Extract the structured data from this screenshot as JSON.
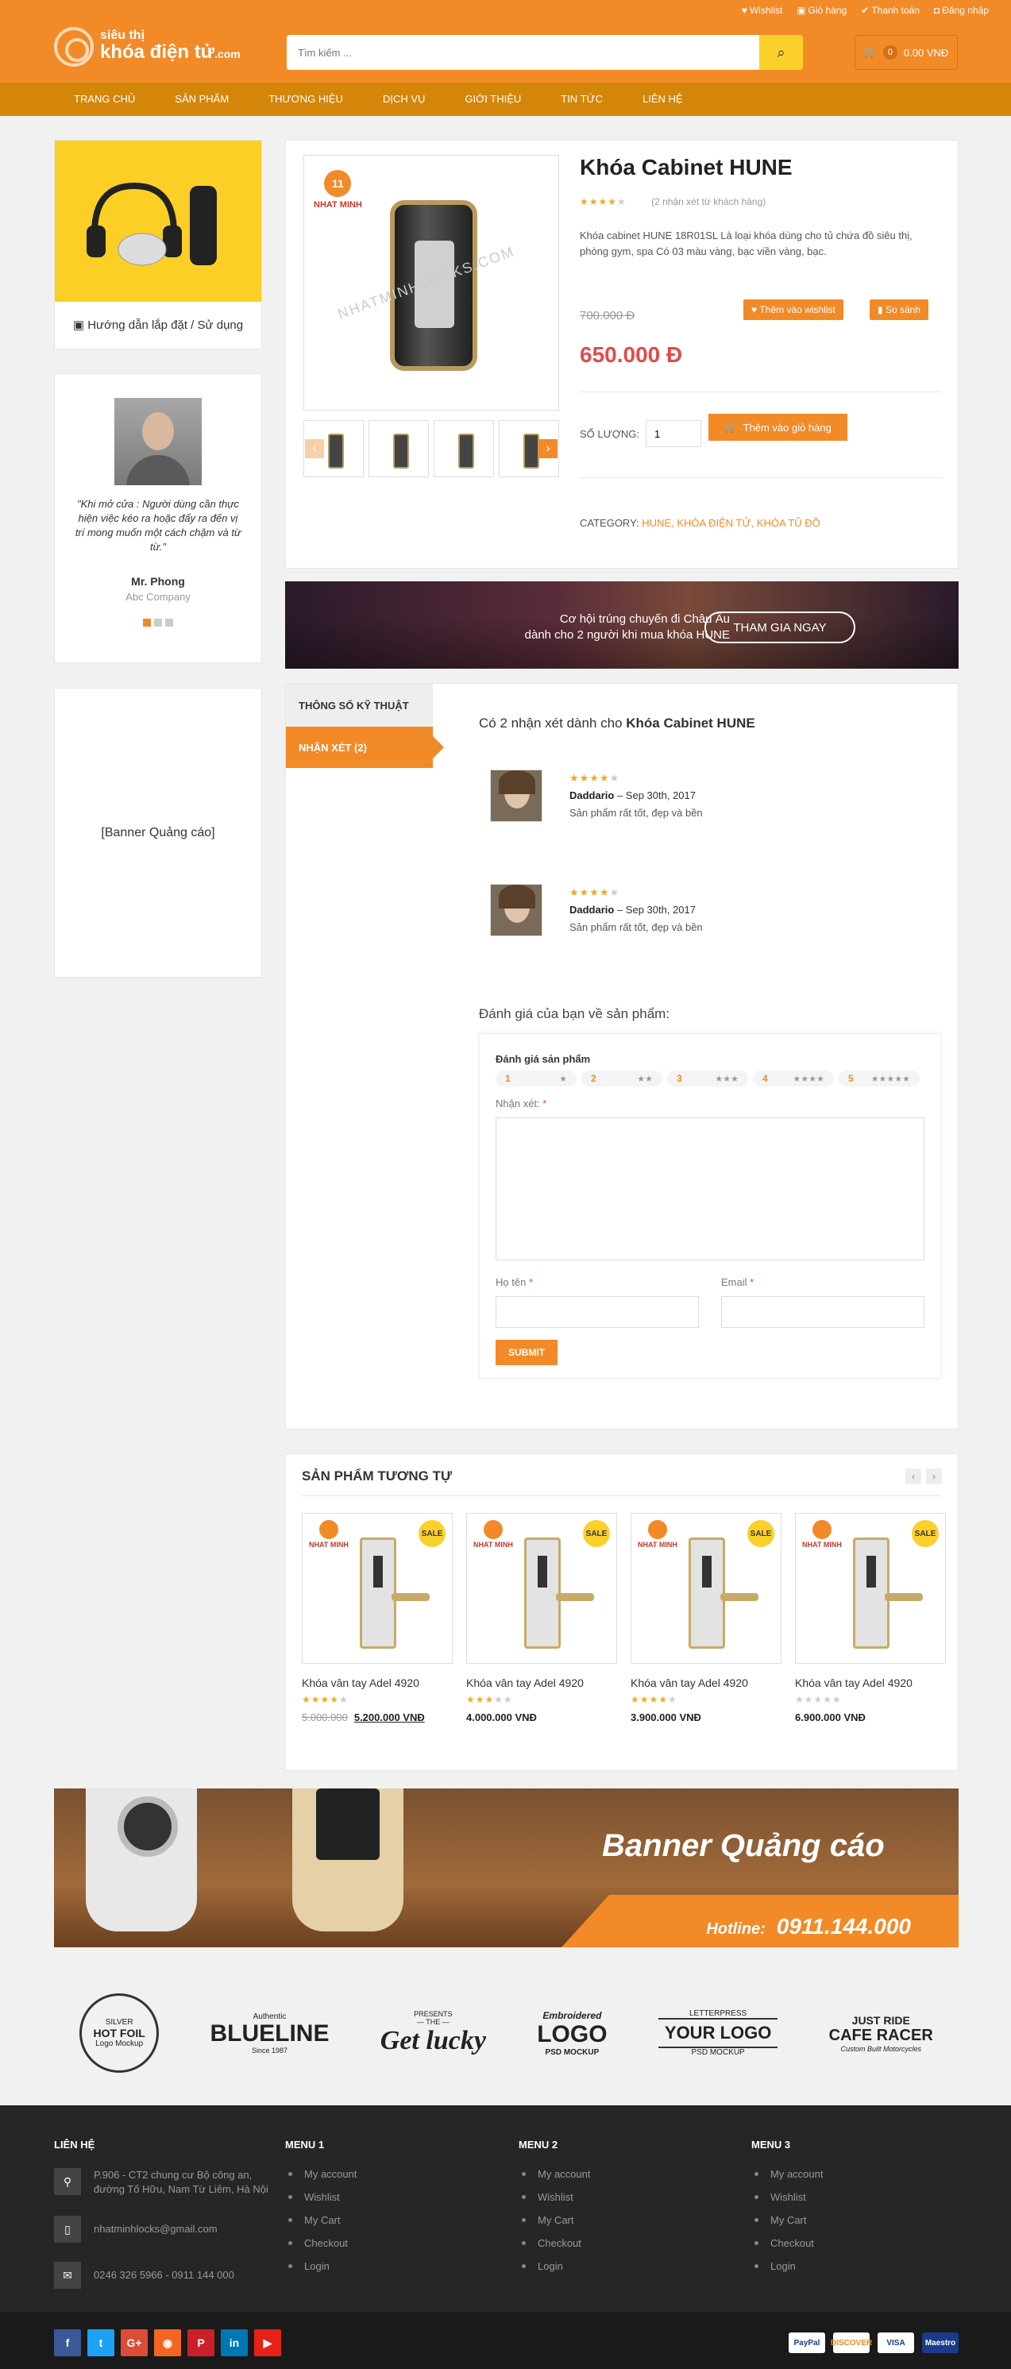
{
  "header": {
    "links": [
      {
        "icon": "♥",
        "label": "Wishlist"
      },
      {
        "icon": "🛒",
        "label": "Giỏ hàng"
      },
      {
        "icon": "✔",
        "label": "Thanh toán"
      },
      {
        "icon": "🔒",
        "label": "Đăng nhập"
      }
    ],
    "logo_line1": "siêu thị",
    "logo_line2": "khóa điện tử",
    "logo_suffix": ".com",
    "search_placeholder": "Tìm kiếm ...",
    "cart_count": "0",
    "cart_total": "0.00 VNĐ"
  },
  "nav": [
    "TRANG CHỦ",
    "SẢN PHẨM",
    "THƯƠNG HIỆU",
    "DỊCH VỤ",
    "GIỚI THIỆU",
    "TIN TỨC",
    "LIÊN HỆ"
  ],
  "sidebar": {
    "guide_caption": "Hướng dẫn lắp đặt / Sử dụng",
    "testimonial": {
      "quote": "\"Khi mở cửa : Người dùng cần thực hiện việc kéo ra hoặc đẩy ra đến vị trí mong muốn một cách chậm và từ từ.\"",
      "name": "Mr. Phong",
      "company": "Abc Company"
    },
    "banner": "[Banner Quảng cáo]"
  },
  "product": {
    "brand": "NHAT MINH",
    "watermark": "NHATMINHLOCKS.COM",
    "title": "Khóa Cabinet HUNE",
    "rating": 4,
    "review_count": "(2 nhận xét từ khách hàng)",
    "description": "Khóa cabinet HUNE 18R01SL Là loại khóa dùng cho tủ chứa đồ siêu thị, phòng gym, spa Có 03 màu vàng, bạc viền vàng, bạc.",
    "wishlist_label": "Thêm vào wishlist",
    "compare_label": "So sánh",
    "old_price": "700.000 Đ",
    "price": "650.000 Đ",
    "qty_label": "SỐ LƯỢNG:",
    "qty": "1",
    "add_cart_label": "Thêm vào giỏ hàng",
    "category_label": "CATEGORY:",
    "categories": "HUNE, KHÓA ĐIỆN TỬ, KHÓA TỦ ĐỒ"
  },
  "promo": {
    "line1": "Cơ hội trúng chuyến đi Châu Âu",
    "line2": "dành cho 2 người khi mua khóa HUNE",
    "cta": "THAM GIA NGAY"
  },
  "reviews": {
    "tab_specs": "THÔNG SỐ KỸ THUẬT",
    "tab_reviews": "NHẬN XÉT (2)",
    "heading_prefix": "Có 2 nhận xét dành cho",
    "heading_product": "Khóa Cabinet HUNE",
    "items": [
      {
        "rating": 4,
        "author": "Daddario",
        "date": "– Sep 30th, 2017",
        "text": "Sản phẩm rất tốt, đẹp và bền"
      },
      {
        "rating": 4,
        "author": "Daddario",
        "date": "– Sep 30th, 2017",
        "text": "Sản phẩm rất tốt, đẹp và bền"
      }
    ],
    "form_title": "Đánh giá của bạn về sản phẩm:",
    "rate_label": "Đánh giá sản phẩm",
    "rate_options": [
      "1",
      "2",
      "3",
      "4",
      "5"
    ],
    "comment_label": "Nhận xét:",
    "name_label": "Họ tên",
    "email_label": "Email",
    "required_mark": "*",
    "submit": "SUBMIT"
  },
  "related": {
    "title": "SẢN PHẨM TƯƠNG TỰ",
    "sale_badge": "SALE",
    "brand": "NHAT MINH",
    "items": [
      {
        "name": "Khóa vân tay Adel 4920",
        "rating": 4,
        "old_price": "5.000.000",
        "price": "5.200.000 VNĐ"
      },
      {
        "name": "Khóa vân tay Adel 4920",
        "rating": 3,
        "old_price": "",
        "price": "4.000.000 VNĐ"
      },
      {
        "name": "Khóa vân tay Adel 4920",
        "rating": 4,
        "old_price": "",
        "price": "3.900.000 VNĐ"
      },
      {
        "name": "Khóa vân tay Adel 4920",
        "rating": 0,
        "old_price": "",
        "price": "6.900.000 VNĐ"
      }
    ]
  },
  "big_banner": {
    "title": "Banner Quảng cáo",
    "hotline_label": "Hotline:",
    "hotline": "0911.144.000"
  },
  "brands": [
    {
      "top": "SILVER",
      "main": "HOT FOIL",
      "sub": "Logo Mockup"
    },
    {
      "top": "Authentic",
      "main": "BLUELINE",
      "sub": "Since 1987"
    },
    {
      "top": "PRESENTS",
      "main": "Get lucky",
      "sub": "— THE —"
    },
    {
      "top": "Embroidered",
      "main": "LOGO",
      "sub": "PSD MOCKUP"
    },
    {
      "top": "LETTERPRESS",
      "main": "YOUR LOGO",
      "sub": "PSD MOCKUP"
    },
    {
      "top": "JUST RIDE",
      "main": "CAFE RACER",
      "sub": "Custom Built Motorcycles"
    }
  ],
  "footer": {
    "contact_title": "LIÊN HỆ",
    "address": "P.906 - CT2 chung cư Bộ công an, đường Tố Hữu, Nam Từ Liêm, Hà Nội",
    "email": "nhatminhlocks@gmail.com",
    "phone": "0246 326 5966 - 0911 144 000",
    "menus": [
      {
        "title": "MENU 1",
        "items": [
          "My account",
          "Wishlist",
          "My Cart",
          "Checkout",
          "Login"
        ]
      },
      {
        "title": "MENU 2",
        "items": [
          "My account",
          "Wishlist",
          "My Cart",
          "Checkout",
          "Login"
        ]
      },
      {
        "title": "MENU 3",
        "items": [
          "My account",
          "Wishlist",
          "My Cart",
          "Checkout",
          "Login"
        ]
      }
    ],
    "socials": [
      {
        "icon": "f",
        "color": "#3b5998"
      },
      {
        "icon": "t",
        "color": "#1da1f2"
      },
      {
        "icon": "G+",
        "color": "#dd4b39"
      },
      {
        "icon": "rss",
        "color": "#f26522"
      },
      {
        "icon": "P",
        "color": "#cb2027"
      },
      {
        "icon": "in",
        "color": "#0077b5"
      },
      {
        "icon": "▶",
        "color": "#e62117"
      }
    ],
    "payments": [
      "PayPal",
      "DISCOVER",
      "VISA",
      "Maestro"
    ]
  },
  "colors": {
    "accent": "#f28a27",
    "nav": "#d4860b",
    "price": "#e34a4a",
    "star": "#f2a91e"
  }
}
